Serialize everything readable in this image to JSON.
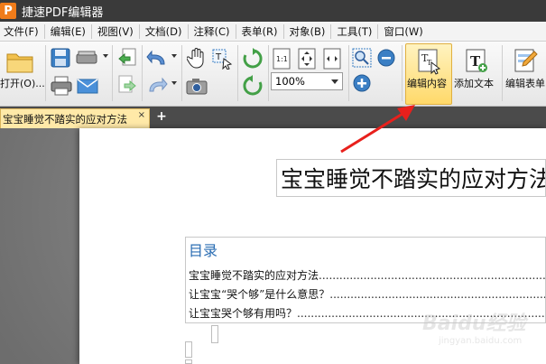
{
  "app": {
    "logo_letter": "P",
    "title": "捷速PDF编辑器"
  },
  "menu": {
    "items": [
      "文件(F)",
      "编辑(E)",
      "视图(V)",
      "文档(D)",
      "注释(C)",
      "表单(R)",
      "对象(B)",
      "工具(T)",
      "窗口(W)"
    ]
  },
  "toolbar": {
    "open_label": "打开(O)...",
    "zoom_value": "100%",
    "edit_content_label": "编辑内容",
    "add_text_label": "添加文本",
    "edit_form_label": "编辑表单",
    "highlight_color": "#ffd96a"
  },
  "tabs": {
    "active_tab": "宝宝睡觉不踏实的应对方法",
    "close_symbol": "×",
    "add_symbol": "+"
  },
  "document": {
    "title": "宝宝睡觉不踏实的应对方法",
    "toc_heading": "目录",
    "toc_items": [
      "宝宝睡觉不踏实的应对方法",
      "让宝宝“哭个够”是什么意思？",
      "让宝宝哭个够有用吗？"
    ]
  },
  "watermark": {
    "brand": "Baidu经验",
    "url": "jingyan.baidu.com"
  },
  "colors": {
    "annotation_arrow": "#e8201c",
    "toc_heading": "#2a6db3"
  }
}
